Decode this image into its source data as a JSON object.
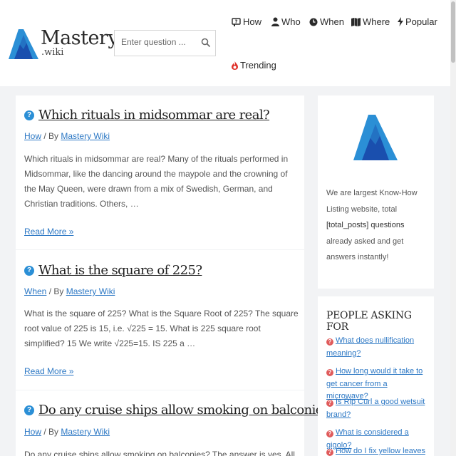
{
  "brand": {
    "name": "Mastery",
    "sub": ".wiki",
    "colors": {
      "primary": "#2b8fd6",
      "dark": "#1a4fae"
    }
  },
  "search": {
    "placeholder": "Enter question ..."
  },
  "nav": [
    {
      "label": "How",
      "icon": "question-sign-icon"
    },
    {
      "label": "Who",
      "icon": "user-icon"
    },
    {
      "label": "When",
      "icon": "clock-icon"
    },
    {
      "label": "Where",
      "icon": "map-icon"
    },
    {
      "label": "Popular",
      "icon": "bolt-icon"
    },
    {
      "label": "Trending",
      "icon": "fire-icon"
    }
  ],
  "articles": [
    {
      "title": "Which rituals in midsommar are real?",
      "category": "How",
      "by": "By",
      "author": "Mastery Wiki",
      "excerpt": "Which rituals in midsommar are real? Many of the rituals performed in Midsommar, like the dancing around the maypole and the crowning of the May Queen, were drawn from a mix of Swedish, German, and Christian traditions. Others, …",
      "read_more": "Read More »"
    },
    {
      "title": "What is the square of 225?",
      "category": "When",
      "by": "By",
      "author": "Mastery Wiki",
      "excerpt": "What is the square of 225? What is the Square Root of 225? The square root value of 225 is 15, i.e. √225 = 15. What is 225 square root simplified? 15 We write √225=15. IS 225 a …",
      "read_more": "Read More »"
    },
    {
      "title": "Do any cruise ships allow smoking on balconies?",
      "category": "How",
      "by": "By",
      "author": "Mastery Wiki",
      "excerpt": "Do any cruise ships allow smoking on balconies? The answer is yes. All cruise",
      "read_more": ""
    }
  ],
  "sidebar": {
    "about": {
      "line1": "We are largest Know-How Listing website, total",
      "highlight": "[total_posts] questions",
      "line2": "already asked and get answers instantly!"
    },
    "people_heading": "PEOPLE ASKING FOR",
    "people": [
      "What does nullification meaning?",
      "How long would it take to get cancer from a microwave?",
      "Is Rip Curl a good wetsuit brand?",
      "What is considered a gigolo?",
      "How do I fix yellow leaves"
    ]
  }
}
